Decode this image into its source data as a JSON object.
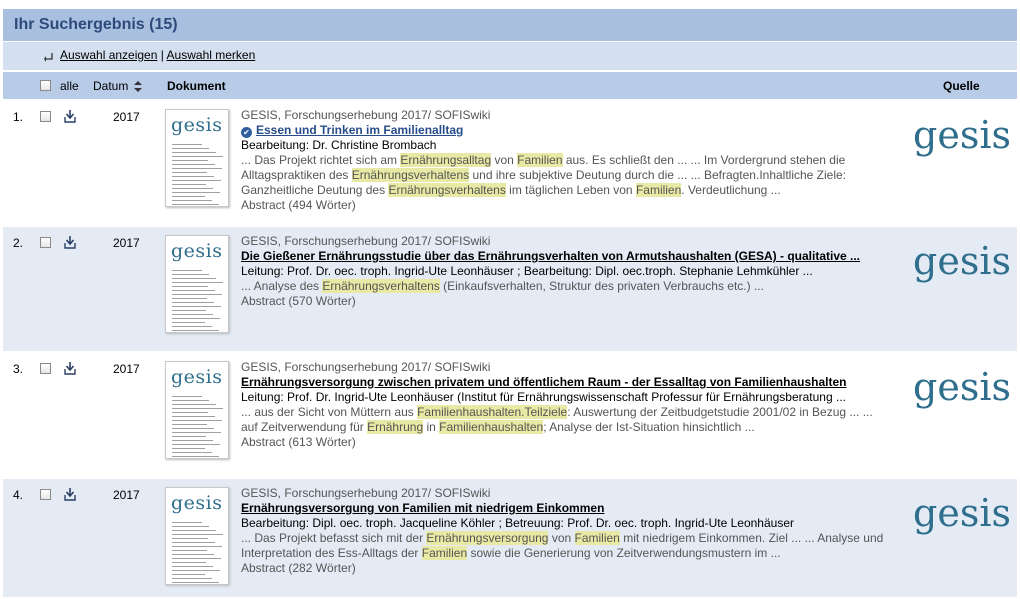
{
  "header": {
    "title": "Ihr Suchergebnis (15)"
  },
  "actions": {
    "show_selection": "Auswahl anzeigen",
    "separator": "|",
    "remember_selection": "Auswahl merken"
  },
  "columns": {
    "all": "alle",
    "date": "Datum",
    "document": "Dokument",
    "source": "Quelle"
  },
  "results": [
    {
      "number": "1.",
      "year": "2017",
      "thumb_logo": "gesis",
      "source": "GESIS, Forschungserhebung 2017/ SOFISwiki",
      "title": "Essen und Trinken im Familienalltag",
      "persons": "Bearbeitung: Dr. Christine Brombach",
      "snippet": [
        {
          "t": "... Das Projekt richtet sich am "
        },
        {
          "t": "Ernährungsalltag",
          "hl": true
        },
        {
          "t": " von "
        },
        {
          "t": "Familien",
          "hl": true
        },
        {
          "t": " aus. Es schließt den ... ... Im Vordergrund stehen die Alltagspraktiken des "
        },
        {
          "t": "Ernährungsverhaltens",
          "hl": true
        },
        {
          "t": " und ihre subjektive Deutung durch die ... ... Befragten.Inhaltliche Ziele: Ganzheitliche Deutung des "
        },
        {
          "t": "Ernährungsverhaltens",
          "hl": true
        },
        {
          "t": " im täglichen Leben von "
        },
        {
          "t": "Familien",
          "hl": true
        },
        {
          "t": ". Verdeutlichung ..."
        }
      ],
      "abstract": "Abstract (494 Wörter)",
      "brand": "gesis"
    },
    {
      "number": "2.",
      "year": "2017",
      "thumb_logo": "gesis",
      "source": "GESIS, Forschungserhebung 2017/ SOFISwiki",
      "title": "Die Gießener Ernährungsstudie über das Ernährungsverhalten von Armutshaushalten (GESA) - qualitative ...",
      "persons": "Leitung: Prof. Dr. oec. troph. Ingrid-Ute Leonhäuser ; Bearbeitung: Dipl. oec.troph. Stephanie Lehmkühler ...",
      "snippet": [
        {
          "t": "... Analyse des "
        },
        {
          "t": "Ernährungsverhaltens",
          "hl": true
        },
        {
          "t": " (Einkaufsverhalten, Struktur des privaten Verbrauchs etc.) ..."
        }
      ],
      "abstract": "Abstract (570 Wörter)",
      "brand": "gesis"
    },
    {
      "number": "3.",
      "year": "2017",
      "thumb_logo": "gesis",
      "source": "GESIS, Forschungserhebung 2017/ SOFISwiki",
      "title": "Ernährungsversorgung zwischen privatem und öffentlichem Raum - der Essalltag von Familienhaushalten",
      "persons": "Leitung: Prof. Dr. Ingrid-Ute Leonhäuser (Institut für Ernährungswissenschaft Professur für Ernährungsberatung ...",
      "snippet": [
        {
          "t": "... aus der Sicht von Müttern aus "
        },
        {
          "t": "Familienhaushalten.Teilziele",
          "hl": true
        },
        {
          "t": ": Auswertung der Zeitbudgetstudie 2001/02 in Bezug ... ... auf Zeitverwendung für "
        },
        {
          "t": "Ernährung",
          "hl": true
        },
        {
          "t": " in "
        },
        {
          "t": "Familienhaushalten",
          "hl": true
        },
        {
          "t": "; Analyse der Ist-Situation hinsichtlich ..."
        }
      ],
      "abstract": "Abstract (613 Wörter)",
      "brand": "gesis"
    },
    {
      "number": "4.",
      "year": "2017",
      "thumb_logo": "gesis",
      "source": "GESIS, Forschungserhebung 2017/ SOFISwiki",
      "title": "Ernährungsversorgung von Familien mit niedrigem Einkommen",
      "persons": "Bearbeitung: Dipl. oec. troph. Jacqueline Köhler ; Betreuung: Prof. Dr. oec. troph. Ingrid-Ute Leonhäuser",
      "snippet": [
        {
          "t": "... Das Projekt befasst sich mit der "
        },
        {
          "t": "Ernährungsversorgung",
          "hl": true
        },
        {
          "t": " von "
        },
        {
          "t": "Familien",
          "hl": true
        },
        {
          "t": " mit niedrigem Einkommen. Ziel ... ... Analyse und Interpretation des Ess-Alltags der "
        },
        {
          "t": "Familien",
          "hl": true
        },
        {
          "t": " sowie die Generierung von Zeitverwendungsmustern im ..."
        }
      ],
      "abstract": "Abstract (282 Wörter)",
      "brand": "gesis"
    }
  ]
}
